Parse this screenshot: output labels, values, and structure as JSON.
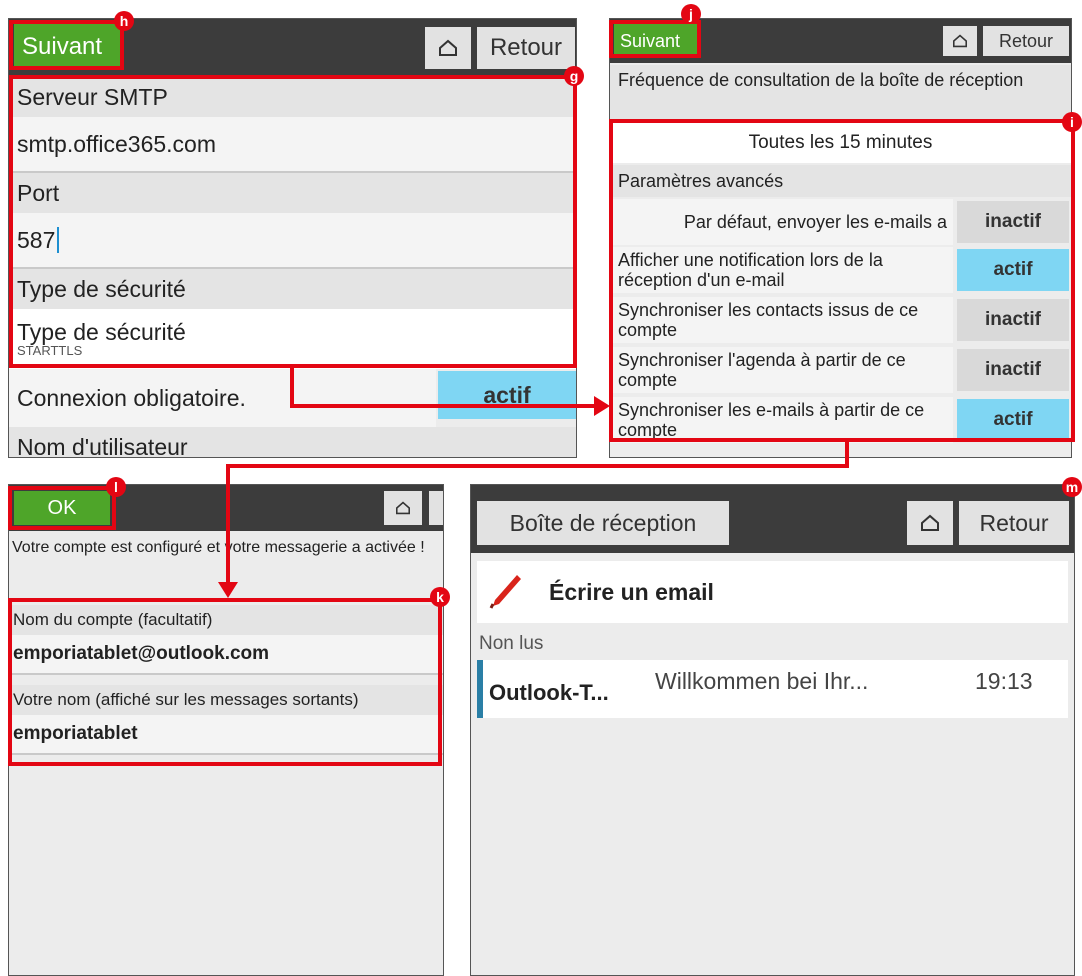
{
  "panel_smtp": {
    "next_label": "Suivant",
    "back_label": "Retour",
    "smtp_server_label": "Serveur SMTP",
    "smtp_server_value": "smtp.office365.com",
    "port_label": "Port",
    "port_value": "587",
    "security_header": "Type de sécurité",
    "security_title": "Type de sécurité",
    "security_value": "STARTTLS",
    "login_required_label": "Connexion obligatoire.",
    "login_required_state": "actif",
    "username_label": "Nom d'utilisateur"
  },
  "panel_options": {
    "next_label": "Suivant",
    "back_label": "Retour",
    "frequency_label": "Fréquence de consultation de la boîte de réception",
    "frequency_value": "Toutes les 15 minutes",
    "advanced_label": "Paramètres avancés",
    "settings": [
      {
        "label": "Par défaut, envoyer les e-mails a",
        "state": "inactif"
      },
      {
        "label": "Afficher une notification lors de la réception d'un e-mail",
        "state": "actif"
      },
      {
        "label": "Synchroniser les contacts issus de ce compte",
        "state": "inactif"
      },
      {
        "label": "Synchroniser l'agenda à partir de ce compte",
        "state": "inactif"
      },
      {
        "label": "Synchroniser les e-mails à partir de ce compte",
        "state": "actif"
      }
    ]
  },
  "panel_account": {
    "ok_label": "OK",
    "message": "Votre compte est configuré et votre messagerie a activée !",
    "account_name_label": "Nom du compte (facultatif)",
    "account_name_value": "emporiatablet@outlook.com",
    "your_name_label": "Votre nom (affiché sur les messages sortants)",
    "your_name_value": "emporiatablet"
  },
  "panel_inbox": {
    "title": "Boîte de réception",
    "back_label": "Retour",
    "compose_label": "Écrire un email",
    "unread_label": "Non lus",
    "messages": [
      {
        "sender": "Outlook-T...",
        "subject": "Willkommen bei Ihr...",
        "time": "19:13"
      }
    ]
  },
  "badges": {
    "g": "g",
    "h": "h",
    "i": "i",
    "j": "j",
    "k": "k",
    "l": "l",
    "m": "m"
  },
  "colors": {
    "accent_green": "#4ea529",
    "active_blue": "#7fd6f3",
    "highlight_red": "#e30613",
    "bar_dark": "#3c3c3c"
  }
}
